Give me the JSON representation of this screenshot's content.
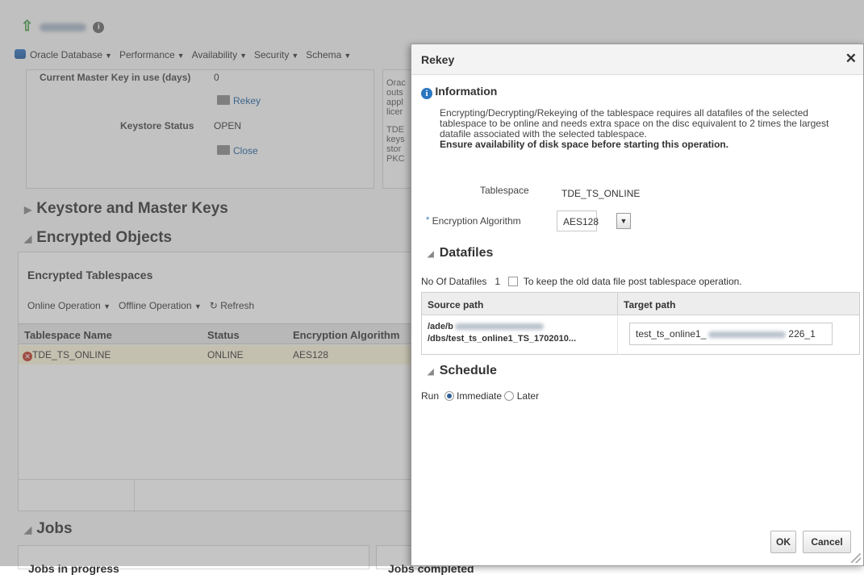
{
  "background": {
    "menu": [
      "Oracle Database",
      "Performance",
      "Availability",
      "Security",
      "Schema"
    ],
    "master_key_label": "Current Master Key in use (days)",
    "master_key_value": "0",
    "rekey_link": "Rekey",
    "keystore_status_label": "Keystore Status",
    "keystore_status_value": "OPEN",
    "close_link": "Close",
    "side_text": [
      "Orac",
      "outs",
      "appl",
      "licer",
      "",
      "TDE",
      "keys",
      "stor",
      "PKC"
    ],
    "section_keystore": "Keystore and Master Keys",
    "section_encrypted": "Encrypted Objects",
    "encrypted_tablespaces_title": "Encrypted Tablespaces",
    "toolbar": {
      "online_op": "Online Operation",
      "offline_op": "Offline Operation",
      "refresh": "Refresh"
    },
    "table_headers": [
      "Tablespace Name",
      "Status",
      "Encryption Algorithm"
    ],
    "table_row": {
      "name": "TDE_TS_ONLINE",
      "status": "ONLINE",
      "algorithm": "AES128"
    },
    "section_jobs": "Jobs",
    "jobs_in_progress": "Jobs in progress",
    "jobs_completed": "Jobs completed"
  },
  "dialog": {
    "title": "Rekey",
    "info_heading": "Information",
    "info_text": "Encrypting/Decrypting/Rekeying of the tablespace requires all datafiles of the selected tablespace to be online and needs extra space on the disc equivalent to 2 times the largest datafile associated with the selected tablespace.",
    "info_warning": "Ensure availability of disk space before starting this operation.",
    "tablespace_label": "Tablespace",
    "tablespace_value": "TDE_TS_ONLINE",
    "encryption_label": "Encryption Algorithm",
    "encryption_value": "AES128",
    "datafiles_heading": "Datafiles",
    "no_of_datafiles_label": "No Of Datafiles",
    "no_of_datafiles_value": "1",
    "keep_old_label": "To keep the old data file post tablespace operation.",
    "col_source": "Source path",
    "col_target": "Target path",
    "source_line1": "/ade/b",
    "source_line2": "/dbs/test_ts_online1_TS_1702010...",
    "target_prefix": "test_ts_online1_",
    "target_suffix": "226_1",
    "schedule_heading": "Schedule",
    "run_label": "Run",
    "immediate_label": "Immediate",
    "later_label": "Later",
    "ok_label": "OK",
    "cancel_label": "Cancel"
  }
}
